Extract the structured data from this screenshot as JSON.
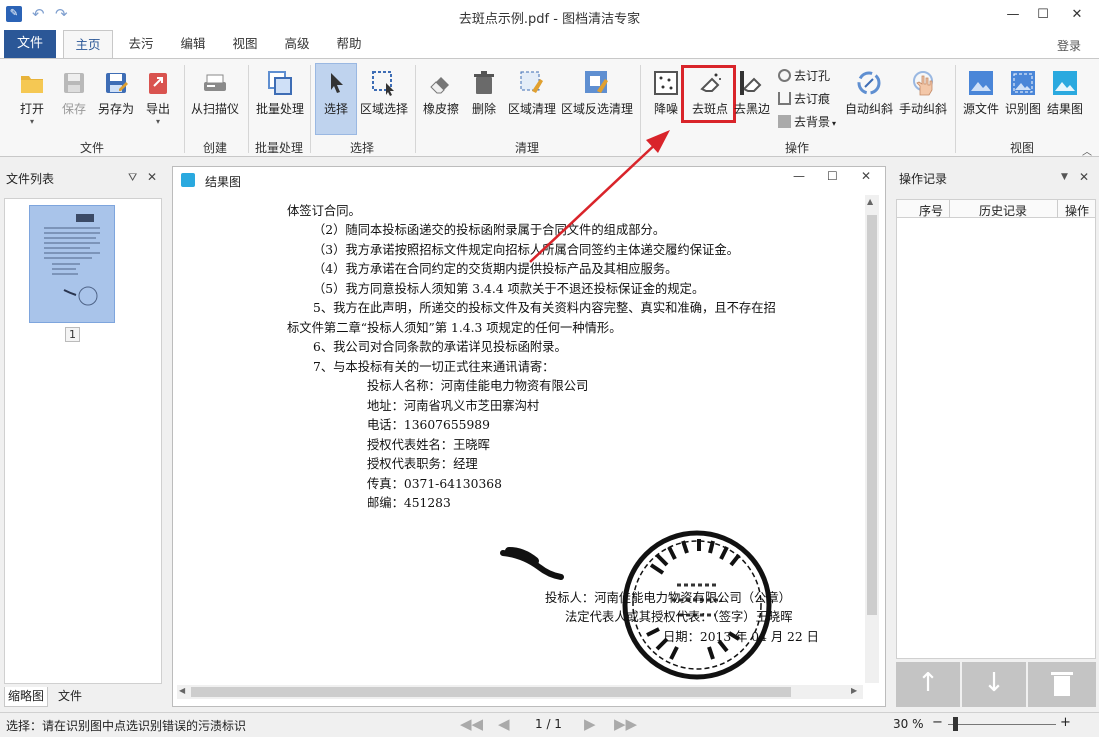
{
  "window": {
    "title": "去斑点示例.pdf - 图档清洁专家",
    "login": "登录"
  },
  "menu": {
    "file": "文件",
    "tabs": [
      "主页",
      "去污",
      "编辑",
      "视图",
      "高级",
      "帮助"
    ]
  },
  "ribbon": {
    "buttons": {
      "open": "打开",
      "save": "保存",
      "saveas": "另存为",
      "export": "导出",
      "scanner": "从扫描仪",
      "batch": "批量处理",
      "select": "选择",
      "region_select": "区域选择",
      "eraser": "橡皮擦",
      "delete": "删除",
      "region_clean": "区域清理",
      "region_reverse_clean": "区域反选清理",
      "denoise": "降噪",
      "despeckle": "去斑点",
      "remove_black_edge": "去黑边",
      "autodeskew": "自动纠斜",
      "manualdeskew": "手动纠斜",
      "source": "源文件",
      "recog": "识别图",
      "result": "结果图"
    },
    "small": {
      "hole": "去订孔",
      "staple": "去订痕",
      "background": "去背景"
    },
    "groups": {
      "file": "文件",
      "create": "创建",
      "batch": "批量处理",
      "select": "选择",
      "clean": "清理",
      "operate": "操作",
      "view": "视图"
    }
  },
  "left_panel": {
    "title": "文件列表",
    "page_num": "1",
    "tabs": [
      "缩略图",
      "文件"
    ]
  },
  "doc": {
    "title": "结果图",
    "lines": [
      "体签订合同。",
      "（2）随同本投标函递交的投标函附录属于合同文件的组成部分。",
      "（3）我方承诺按照招标文件规定向招标人所属合同签约主体递交履约保证金。",
      "（4）我方承诺在合同约定的交货期内提供投标产品及其相应服务。",
      "（5）我方同意投标人须知第 3.4.4 项款关于不退还投标保证金的规定。",
      "5、我方在此声明，所递交的投标文件及有关资料内容完整、真实和准确，且不存在招",
      "标文件第二章“投标人须知”第 1.4.3 项规定的任何一种情形。",
      "6、我公司对合同条款的承诺详见投标函附录。",
      "7、与本投标有关的一切正式往来通讯请寄：",
      "投标人名称：河南佳能电力物资有限公司",
      "地址：河南省巩义市芝田寨沟村",
      "电话：13607655989",
      "授权代表姓名：王晓晖",
      "授权代表职务：经理",
      "传真：0371-64130368",
      "邮编：451283"
    ],
    "sign": [
      "投标人：河南佳能电力物资有限公司（公章）",
      "法定代表人或其授权代表：（签字）王晓晖",
      "日期：2013 年 04 月 22 日"
    ]
  },
  "right_panel": {
    "title": "操作记录",
    "columns": [
      "序号",
      "历史记录",
      "操作"
    ]
  },
  "status": {
    "text": "选择：请在识别图中点选识别错误的污渍标识",
    "page": "1 / 1",
    "zoom": "30 %"
  },
  "colors": {
    "accent": "#2b5797",
    "highlight": "#d9242a",
    "selected_bg": "#bfd3ee"
  }
}
